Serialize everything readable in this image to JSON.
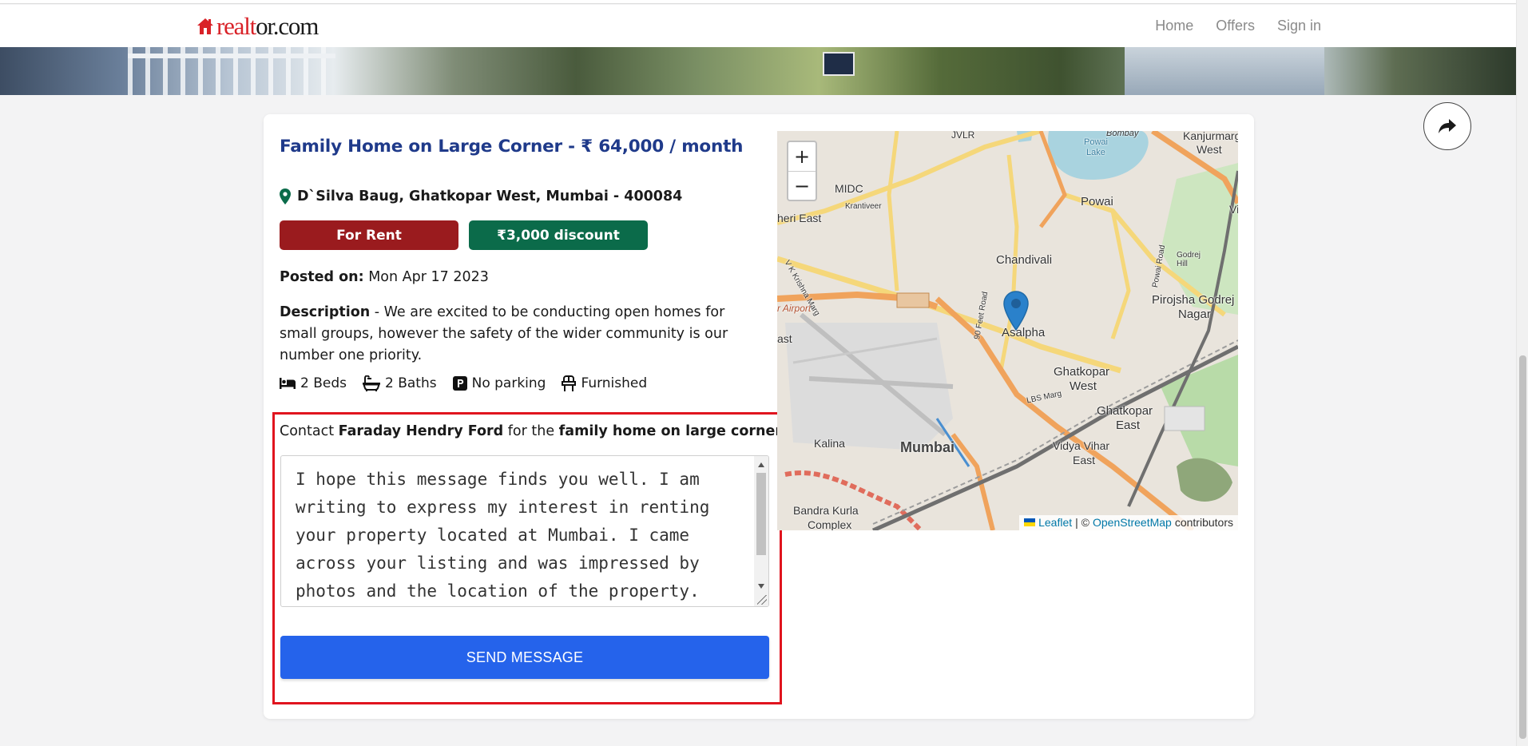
{
  "header": {
    "logo_part1": "realt",
    "logo_part2": "or.com",
    "nav": [
      "Home",
      "Offers",
      "Sign in"
    ]
  },
  "listing": {
    "title": "Family Home on Large Corner - ₹ 64,000 / month",
    "address": "D`Silva Baug, Ghatkopar West, Mumbai - 400084",
    "badge_rent": "For Rent",
    "badge_discount": "₹3,000 discount",
    "posted_label": "Posted on:",
    "posted_value": "Mon Apr 17 2023",
    "description_label": "Description",
    "description_text": " - We are excited to be conducting open homes for small groups, however the safety of the wider community is our number one priority.",
    "features": {
      "beds": "2 Beds",
      "baths": "2 Baths",
      "parking": "No parking",
      "furnished": "Furnished"
    }
  },
  "contact": {
    "prefix": "Contact ",
    "owner": "Faraday Hendry Ford",
    "middle": " for the ",
    "property": "family home on large corner",
    "message": "I hope this message finds you well. I am writing to express my interest in renting your property located at Mumbai. I came across your listing and was impressed by photos and the location of the property.",
    "send_label": "SEND MESSAGE"
  },
  "map": {
    "zoom_in": "+",
    "zoom_out": "−",
    "attribution_leaflet": "Leaflet",
    "attribution_sep": "| ©",
    "attribution_osm": "OpenStreetMap",
    "attribution_tail": "contributors",
    "labels": {
      "jvlr": "JVLR",
      "bombay": "Bombay",
      "kanjurmarg": "Kanjurmarg",
      "west": "West",
      "powai_lake": "Powai",
      "lake": "Lake",
      "midc": "MIDC",
      "heri_east": "heri East",
      "powai": "Powai",
      "chandivali": "Chandivali",
      "vi": "Vi",
      "pirojsha": "Pirojsha Godrej",
      "nagar": "Nagar",
      "godrej_hill": "Godrej Hill",
      "r_airport": "r Airport",
      "ast": "ast",
      "asalpha": "Asalpha",
      "ghatkopar_w1": "Ghatkopar",
      "ghatkopar_w2": "West",
      "lbs": "LBS Marg",
      "ghatkopar_e1": "Ghatkopar",
      "ghatkopar_e2": "East",
      "kalina": "Kalina",
      "mumbai": "Mumbai",
      "vidyavihar1": "Vidya Vihar",
      "vidyavihar2": "East",
      "bkc1": "Bandra Kurla",
      "bkc2": "Complex",
      "feet_road": "90 Feet Road",
      "krantiveer": "Krantiveer",
      "vk_krishna": "V K Krishna Marg",
      "powai_road": "Powai Road"
    }
  },
  "colors": {
    "title": "#1f3a8a",
    "rent_badge": "#9a1b1e",
    "discount_badge": "#0b6b4a",
    "send_button": "#2563eb",
    "contact_border": "#e0141e",
    "brand_red": "#d92228"
  },
  "icons": [
    "house-logo-icon",
    "share-icon",
    "map-pin-icon",
    "bed-icon",
    "bath-icon",
    "parking-icon",
    "furnished-icon",
    "map-marker-icon"
  ]
}
